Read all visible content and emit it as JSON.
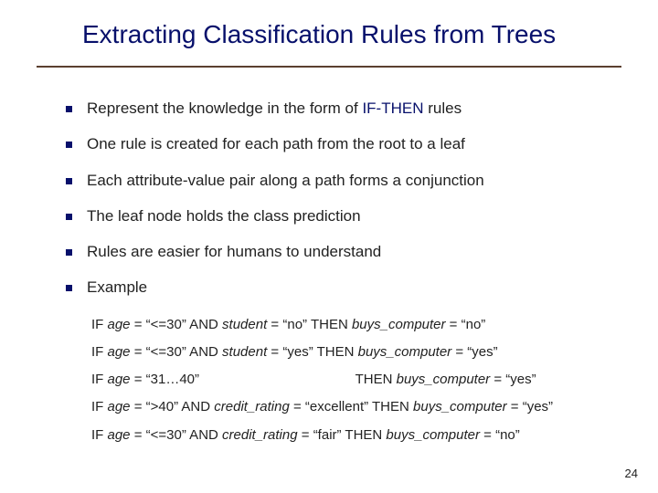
{
  "title": "Extracting Classification Rules from Trees",
  "bullets": [
    {
      "pre": "Represent the knowledge in the form of ",
      "key": "IF-THEN",
      "post": " rules"
    },
    {
      "pre": "One rule is created for each path from the root to a leaf",
      "key": "",
      "post": ""
    },
    {
      "pre": "Each attribute-value pair along a path forms a conjunction",
      "key": "",
      "post": ""
    },
    {
      "pre": "The leaf node holds the class prediction",
      "key": "",
      "post": ""
    },
    {
      "pre": "Rules are easier for humans to understand",
      "key": "",
      "post": ""
    },
    {
      "pre": "Example",
      "key": "",
      "post": ""
    }
  ],
  "ex": {
    "if": "IF ",
    "and": " AND ",
    "then": "  THEN ",
    "age": "age",
    "student": "student",
    "credit": "credit_rating",
    "buys": "buys_computer",
    "eq": " = ",
    "v_le30": "“<=30”",
    "v_3140": "“31…40”",
    "v_gt40": "“>40”",
    "v_no": "“no”",
    "v_yes": "“yes”",
    "v_excellent": "“excellent”",
    "v_fair": "“fair”"
  },
  "page_number": "24"
}
